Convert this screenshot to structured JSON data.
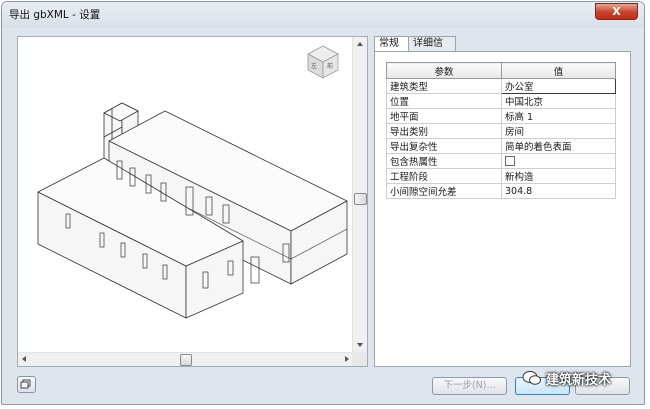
{
  "window": {
    "title": "导出 gbXML - 设置",
    "close_glyph": "X"
  },
  "viewcube": {
    "faces": [
      "左",
      "前"
    ]
  },
  "tabs": [
    {
      "label": "常规",
      "active": true
    },
    {
      "label": "详细信息",
      "active": false
    }
  ],
  "table": {
    "headers": [
      "参数",
      "值"
    ],
    "rows": [
      {
        "param": "建筑类型",
        "value": "办公室"
      },
      {
        "param": "位置",
        "value": "中国北京"
      },
      {
        "param": "地平面",
        "value": "标高 1"
      },
      {
        "param": "导出类别",
        "value": "房间"
      },
      {
        "param": "导出复杂性",
        "value": "简单的着色表面"
      },
      {
        "param": "包含热属性",
        "value": "",
        "checkbox": true,
        "checked": false
      },
      {
        "param": "工程阶段",
        "value": "新构造"
      },
      {
        "param": "小间隙空间允差",
        "value": "304.8"
      }
    ]
  },
  "buttons": {
    "next": "下一步(N)...",
    "save": "",
    "cancel": ""
  },
  "watermark": "建筑新技术"
}
